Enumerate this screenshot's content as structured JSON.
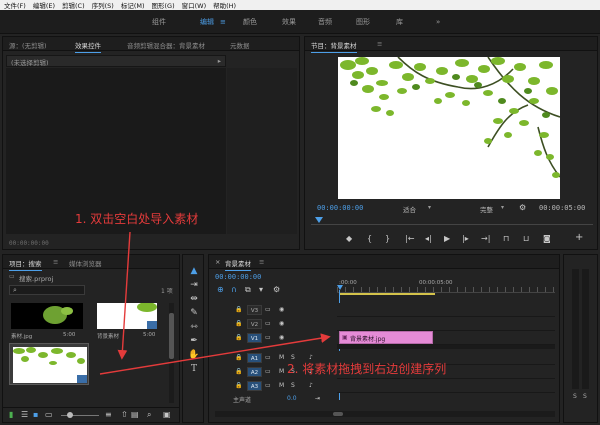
{
  "menu": [
    "文件(F)",
    "编辑(E)",
    "剪辑(C)",
    "序列(S)",
    "标记(M)",
    "图形(G)",
    "窗口(W)",
    "帮助(H)"
  ],
  "workspaces": [
    {
      "label": "组件",
      "active": false
    },
    {
      "label": "编辑",
      "active": true
    },
    {
      "label": "颜色",
      "active": false
    },
    {
      "label": "效果",
      "active": false
    },
    {
      "label": "音频",
      "active": false
    },
    {
      "label": "图形",
      "active": false
    },
    {
      "label": "库",
      "active": false
    }
  ],
  "workspace_menu": "≡",
  "workspace_more": "»",
  "source_panel": {
    "tabs": [
      "源：(无剪辑)",
      "效果控件",
      "音频剪辑混合器：背景素材",
      "元数据"
    ],
    "active_tab": 1,
    "no_clip": "(未选择剪辑)",
    "timecode": "00:00:00:00"
  },
  "program_panel": {
    "title": "节目：背景素材",
    "timecode": "00:00:00:00",
    "fit": "适合",
    "quality": "完整",
    "duration": "00:00:05:00"
  },
  "project_panel": {
    "tabs": [
      "项目：搜索",
      "媒体浏览器"
    ],
    "project_name": "搜索.prproj",
    "item_count": "1 项",
    "items": [
      {
        "name": "素材.jpg",
        "duration": "5:00"
      },
      {
        "name": "背景素材",
        "duration": "5:00"
      }
    ]
  },
  "timeline": {
    "title": "背景素材",
    "timecode": "00:00:00:00",
    "ruler": [
      ":00:00",
      "00:00:05:00"
    ],
    "video_tracks": [
      "V3",
      "V2",
      "V1"
    ],
    "audio_tracks": [
      "A1",
      "A2",
      "A3"
    ],
    "master": "主声道",
    "master_level": "0.0",
    "clip_label": "背景素材.jpg"
  },
  "annotations": {
    "step1": "1. 双击空白处导入素材",
    "step2": "2. 将素材拖拽到右边创建序列"
  },
  "meter": [
    "S",
    "S"
  ],
  "colors": {
    "accent": "#4d9fe8",
    "annotation": "#e43b3b",
    "clip": "#e58bd6"
  }
}
